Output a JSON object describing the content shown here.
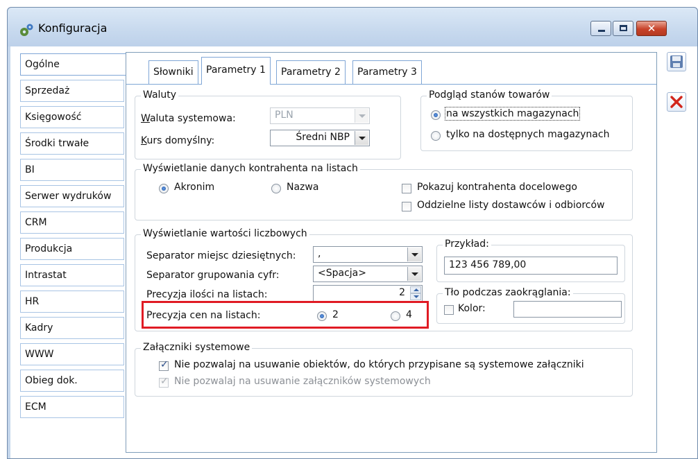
{
  "window": {
    "title": "Konfiguracja"
  },
  "nav": {
    "items": [
      {
        "label": "Ogólne",
        "active": true
      },
      {
        "label": "Sprzedaż"
      },
      {
        "label": "Księgowość"
      },
      {
        "label": "Środki trwałe"
      },
      {
        "label": "BI"
      },
      {
        "label": "Serwer wydruków"
      },
      {
        "label": "CRM"
      },
      {
        "label": "Produkcja"
      },
      {
        "label": "Intrastat"
      },
      {
        "label": "HR"
      },
      {
        "label": "Kadry"
      },
      {
        "label": "WWW"
      },
      {
        "label": "Obieg dok."
      },
      {
        "label": "ECM"
      }
    ]
  },
  "tabs": [
    {
      "label": "Słowniki"
    },
    {
      "label": "Parametry 1",
      "active": true
    },
    {
      "label": "Parametry 2"
    },
    {
      "label": "Parametry 3"
    }
  ],
  "waluty": {
    "legend": "Waluty",
    "system_label_u": "W",
    "system_label_rest": "aluta systemowa:",
    "system_value": "PLN",
    "kurs_label_u": "K",
    "kurs_label_rest": "urs domyślny:",
    "kurs_value": "Średni NBP"
  },
  "podglad": {
    "legend": "Podgląd stanów towarów",
    "option_all": "na wszystkich magazynach",
    "option_available": "tylko na dostępnych magazynach"
  },
  "kontrahent": {
    "legend": "Wyświetlanie danych kontrahenta na listach",
    "opt_akronim": "Akronim",
    "opt_nazwa": "Nazwa",
    "chk_docelowy": "Pokazuj kontrahenta docelowego",
    "chk_oddzielne": "Oddzielne listy dostawców i odbiorców"
  },
  "liczby": {
    "legend": "Wyświetlanie wartości liczbowych",
    "sep_dec_label": "Separator miejsc dziesiętnych:",
    "sep_dec_value": ",",
    "sep_grp_label": "Separator grupowania cyfr:",
    "sep_grp_value": "<Spacja>",
    "prec_ilosci_label": "Precyzja ilości na listach:",
    "prec_ilosci_value": "2",
    "prec_cen_label": "Precyzja cen na listach:",
    "prec_cen_opt2": "2",
    "prec_cen_opt4": "4",
    "przyklad_legend": "Przykład:",
    "przyklad_value": "123 456 789,00",
    "tlo_legend": "Tło podczas zaokrąglania:",
    "kolor_label": "Kolor:"
  },
  "zalaczniki": {
    "legend": "Załączniki systemowe",
    "chk_obiekty": "Nie pozwalaj na usuwanie obiektów, do których przypisane są systemowe załączniki",
    "chk_zalaczniki": "Nie pozwalaj na usuwanie załączników systemowych"
  },
  "colors": {
    "highlight": "#e01b24",
    "accent": "#1a4f9e"
  }
}
